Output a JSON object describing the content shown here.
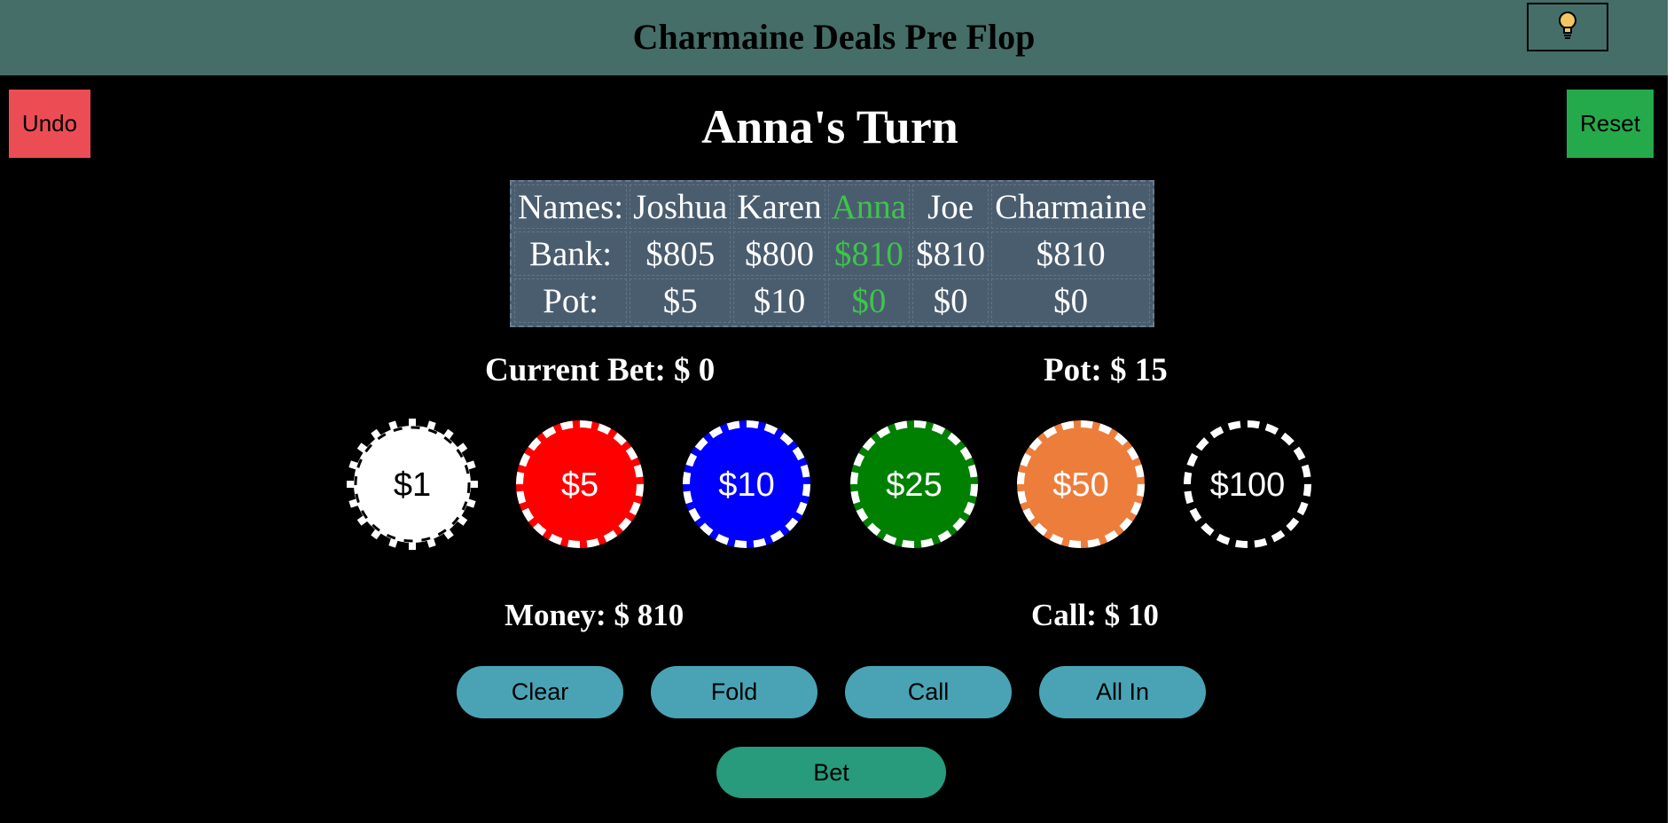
{
  "header": {
    "title": "Charmaine Deals Pre Flop",
    "hint_icon": "lightbulb-icon"
  },
  "controls": {
    "undo_label": "Undo",
    "reset_label": "Reset"
  },
  "turn_title": "Anna's Turn",
  "table": {
    "row_labels": [
      "Names:",
      "Bank:",
      "Pot:"
    ],
    "players": [
      {
        "name": "Joshua",
        "bank": "$805",
        "pot": "$5",
        "active": false
      },
      {
        "name": "Karen",
        "bank": "$800",
        "pot": "$10",
        "active": false
      },
      {
        "name": "Anna",
        "bank": "$810",
        "pot": "$0",
        "active": true
      },
      {
        "name": "Joe",
        "bank": "$810",
        "pot": "$0",
        "active": false
      },
      {
        "name": "Charmaine",
        "bank": "$810",
        "pot": "$0",
        "active": false
      }
    ]
  },
  "status": {
    "current_bet": "Current Bet: $ 0",
    "pot": "Pot: $ 15",
    "money": "Money: $ 810",
    "call": "Call: $ 10"
  },
  "chips": [
    {
      "label": "$1",
      "fill": "#ffffff",
      "stripe": "#ffffff",
      "text_color": "#000000",
      "style": "notched"
    },
    {
      "label": "$5",
      "fill": "#ff0000",
      "stripe": "#ffffff",
      "text_color": "#ffffff",
      "style": "dashed"
    },
    {
      "label": "$10",
      "fill": "#0000ff",
      "stripe": "#ffffff",
      "text_color": "#ffffff",
      "style": "dashed"
    },
    {
      "label": "$25",
      "fill": "#008000",
      "stripe": "#ffffff",
      "text_color": "#ffffff",
      "style": "dashed"
    },
    {
      "label": "$50",
      "fill": "#ed7d3b",
      "stripe": "#ffffff",
      "text_color": "#ffffff",
      "style": "dashed"
    },
    {
      "label": "$100",
      "fill": "#000000",
      "stripe": "#ffffff",
      "text_color": "#ffffff",
      "style": "dashed"
    }
  ],
  "actions": {
    "clear": "Clear",
    "fold": "Fold",
    "call": "Call",
    "all_in": "All In",
    "bet": "Bet"
  },
  "colors": {
    "header_bg": "#466e68",
    "undo_bg": "#ec4d55",
    "reset_bg": "#25aa4b",
    "action_bg": "#4aa3b4",
    "bet_bg": "#279b7c",
    "active_player": "#3dc54a",
    "table_bg": "#4a5d6f"
  }
}
